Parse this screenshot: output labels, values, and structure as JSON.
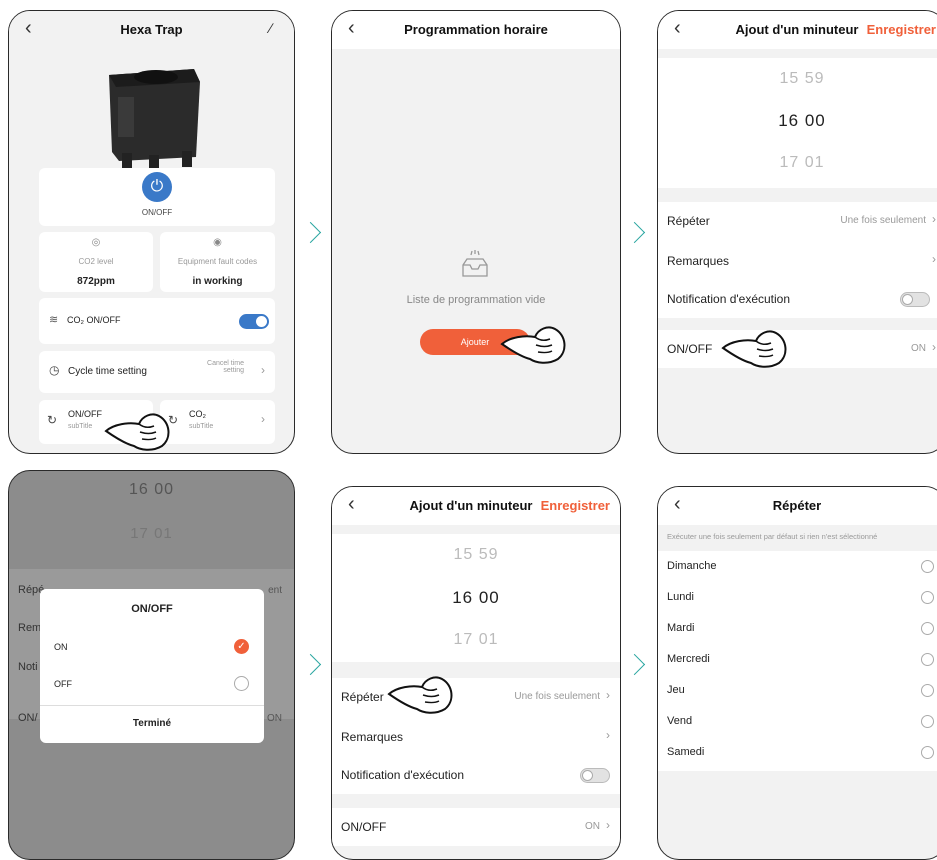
{
  "colors": {
    "accent": "#f0603a",
    "teal": "#2aa6a1",
    "blue": "#3a79c8"
  },
  "screen1": {
    "title": "Hexa Trap",
    "power_label": "ON/OFF",
    "co2": {
      "label": "CO2 level",
      "value": "872ppm"
    },
    "fault": {
      "label": "Equipment fault codes",
      "value": "in working"
    },
    "co2_toggle_label": "CO₂ ON/OFF",
    "cycle": {
      "label": "Cycle time setting",
      "value": "Cancel time setting"
    },
    "timers": [
      {
        "title": "ON/OFF",
        "sub": "subTitle"
      },
      {
        "title": "CO₂",
        "sub": "subTitle"
      }
    ]
  },
  "screen2": {
    "title": "Programmation horaire",
    "empty_text": "Liste de programmation vide",
    "add_label": "Ajouter"
  },
  "screen3": {
    "title": "Ajout d'un minuteur",
    "save": "Enregistrer",
    "times": [
      "15  59",
      "16  00",
      "17  01"
    ],
    "repeat": {
      "label": "Répéter",
      "value": "Une fois seulement"
    },
    "notes": "Remarques",
    "notif": "Notification d'exécution",
    "onoff": {
      "label": "ON/OFF",
      "value": "ON"
    }
  },
  "screen4": {
    "bg_times": [
      "16  00",
      "17  01"
    ],
    "bg_repeat": "Répé",
    "bg_repeat_value": "ent",
    "bg_notes": "Rem",
    "bg_notif": "Noti",
    "bg_onoff": "ON/",
    "bg_onoff_value": "ON",
    "dialog": {
      "title": "ON/OFF",
      "options": [
        {
          "label": "ON",
          "checked": true
        },
        {
          "label": "OFF",
          "checked": false
        }
      ],
      "done": "Terminé"
    }
  },
  "screen5": {
    "title": "Ajout d'un minuteur",
    "save": "Enregistrer",
    "times": [
      "15  59",
      "16  00",
      "17  01"
    ],
    "repeat": {
      "label": "Répéter",
      "value": "Une fois seulement"
    },
    "notes": "Remarques",
    "notif": "Notification d'exécution",
    "onoff": {
      "label": "ON/OFF",
      "value": "ON"
    }
  },
  "screen6": {
    "title": "Répéter",
    "hint": "Exécuter une fois seulement par défaut si rien n'est sélectionné",
    "days": [
      "Dimanche",
      "Lundi",
      "Mardi",
      "Mercredi",
      "Jeu",
      "Vend",
      "Samedi"
    ]
  }
}
